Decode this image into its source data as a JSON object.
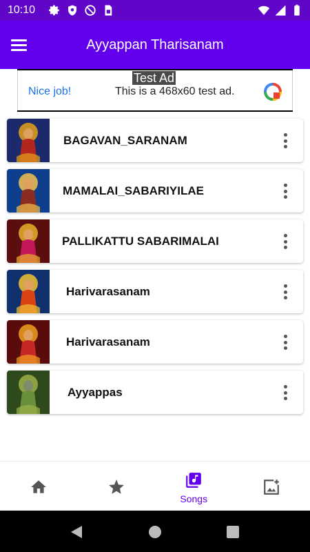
{
  "status_bar": {
    "time": "10:10",
    "bg_color": "#5F06C9"
  },
  "app_bar": {
    "title": "Ayyappan Tharisanam",
    "menu_icon": "hamburger-icon",
    "bg_color": "#6200EE"
  },
  "ad": {
    "tag": "Test Ad",
    "headline": "Nice job!",
    "body": "This is a 468x60 test ad.",
    "logo_icon": "ad-choices-logo"
  },
  "songs": [
    {
      "title": "BAGAVAN_SARANAM",
      "thumb_icon": "ayyappan-image"
    },
    {
      "title": "MAMALAI_SABARIYILAE",
      "thumb_icon": "ayyappan-image"
    },
    {
      "title": "PALLIKATTU SABARIMALAI",
      "thumb_icon": "ayyappan-image"
    },
    {
      "title": "Harivarasanam",
      "thumb_icon": "ayyappan-image"
    },
    {
      "title": "Harivarasanam",
      "thumb_icon": "ayyappan-image"
    },
    {
      "title": "Ayyappas",
      "thumb_icon": "ganesha-image"
    }
  ],
  "bottom_nav": {
    "active_color": "#6200EE",
    "items": [
      {
        "icon": "home-icon",
        "label": ""
      },
      {
        "icon": "star-icon",
        "label": ""
      },
      {
        "icon": "music-library-icon",
        "label": "Songs"
      },
      {
        "icon": "gallery-icon",
        "label": ""
      }
    ]
  }
}
